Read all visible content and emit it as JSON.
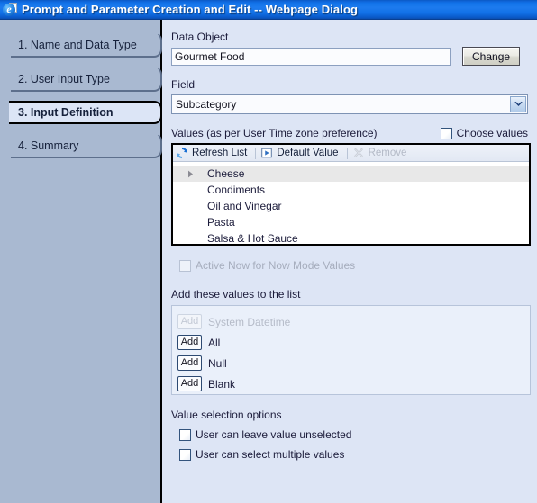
{
  "window": {
    "title": "Prompt and Parameter Creation and Edit -- Webpage Dialog",
    "icon": "internet-explorer-icon",
    "glyph": "e"
  },
  "sidebar": {
    "items": [
      {
        "label": "1. Name and Data Type",
        "active": false
      },
      {
        "label": "2. User Input Type",
        "active": false
      },
      {
        "label": "3. Input Definition",
        "active": true
      },
      {
        "label": "4. Summary",
        "active": false
      }
    ]
  },
  "main": {
    "data_object": {
      "label": "Data Object",
      "value": "Gourmet Food",
      "placeholder": "",
      "change_button": "Change"
    },
    "field": {
      "label": "Field",
      "selected": "Subcategory",
      "arrow_icon": "chevron-down-icon"
    },
    "values": {
      "label": "Values (as per User Time zone preference)",
      "choose_values": {
        "label": "Choose values",
        "checked": false
      },
      "toolbar": {
        "refresh": {
          "label": "Refresh List",
          "icon": "refresh-icon",
          "disabled": false
        },
        "default_value": {
          "label": "Default Value",
          "icon": "play-triangle-icon",
          "disabled": false
        },
        "remove": {
          "label": "Remove",
          "icon": "x-mark-icon",
          "disabled": true
        }
      },
      "items": [
        {
          "label": "Cheese",
          "selected": true,
          "marker": "triangle-right-icon"
        },
        {
          "label": "Condiments",
          "selected": false,
          "marker": ""
        },
        {
          "label": "Oil and Vinegar",
          "selected": false,
          "marker": ""
        },
        {
          "label": "Pasta",
          "selected": false,
          "marker": ""
        },
        {
          "label": "Salsa & Hot Sauce",
          "selected": false,
          "marker": ""
        }
      ]
    },
    "active_now": {
      "label": "Active Now for Now Mode Values",
      "checked": false,
      "disabled": true
    },
    "add_values": {
      "label": "Add these values to the list",
      "rows": [
        {
          "button": "Add",
          "label": "System Datetime",
          "disabled": true
        },
        {
          "button": "Add",
          "label": "All",
          "disabled": false
        },
        {
          "button": "Add",
          "label": "Null",
          "disabled": false
        },
        {
          "button": "Add",
          "label": "Blank",
          "disabled": false
        }
      ]
    },
    "value_selection": {
      "label": "Value selection options",
      "options": [
        {
          "label": "User can leave value unselected",
          "checked": false
        },
        {
          "label": "User can select multiple values",
          "checked": false
        }
      ]
    }
  },
  "colors": {
    "titlebar_blue": "#1172e8",
    "sidebar_blue": "#a9b9d1",
    "panel_blue": "#dde5f5",
    "active_tab": "#dce5f6",
    "selection_grey": "#e8e8e8"
  }
}
